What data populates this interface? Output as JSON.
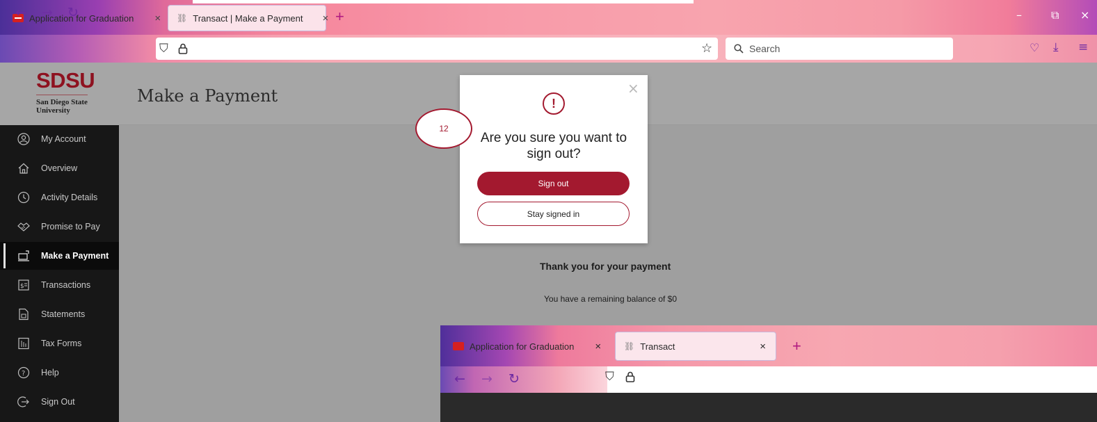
{
  "browser": {
    "tabs": [
      {
        "title": "Application for Graduation",
        "favicon": "sdsu-favicon-icon",
        "close": "×"
      },
      {
        "title": "Transact | Make a Payment",
        "favicon": "link-icon",
        "close": "×"
      }
    ],
    "new_tab": "+",
    "search_placeholder": "Search",
    "window_controls": {
      "minimize": "–",
      "restore": "⧉",
      "close": "×"
    }
  },
  "page": {
    "logo": {
      "wordmark": "SDSU",
      "name": "San Diego State University"
    },
    "title": "Make a Payment",
    "thanks": "Thank you for your payment",
    "balance": "You have a remaining balance of $0"
  },
  "sidebar": {
    "items": [
      {
        "label": "My Account",
        "icon": "user-circle-icon",
        "active": false
      },
      {
        "label": "Overview",
        "icon": "home-icon",
        "active": false
      },
      {
        "label": "Activity Details",
        "icon": "clock-icon",
        "active": false
      },
      {
        "label": "Promise to Pay",
        "icon": "handshake-icon",
        "active": false
      },
      {
        "label": "Make a Payment",
        "icon": "payment-icon",
        "active": true
      },
      {
        "label": "Transactions",
        "icon": "dollar-doc-icon",
        "active": false
      },
      {
        "label": "Statements",
        "icon": "statement-icon",
        "active": false
      },
      {
        "label": "Tax Forms",
        "icon": "tax-form-icon",
        "active": false
      },
      {
        "label": "Help",
        "icon": "help-icon",
        "active": false
      },
      {
        "label": "Sign Out",
        "icon": "sign-out-icon",
        "active": false
      }
    ]
  },
  "modal": {
    "icon": "!",
    "question": "Are you sure you want to sign out?",
    "primary": "Sign out",
    "secondary": "Stay signed in",
    "close": "×"
  },
  "annotation": {
    "step": "12"
  },
  "inset": {
    "tabs": [
      {
        "title": "Application for Graduation",
        "close": "×"
      },
      {
        "title": "Transact",
        "close": "×"
      }
    ],
    "new_tab": "+"
  },
  "colors": {
    "brand_red": "#a3192f",
    "sidebar_bg": "#171717",
    "overlay_gray": "#9f9f9f"
  }
}
